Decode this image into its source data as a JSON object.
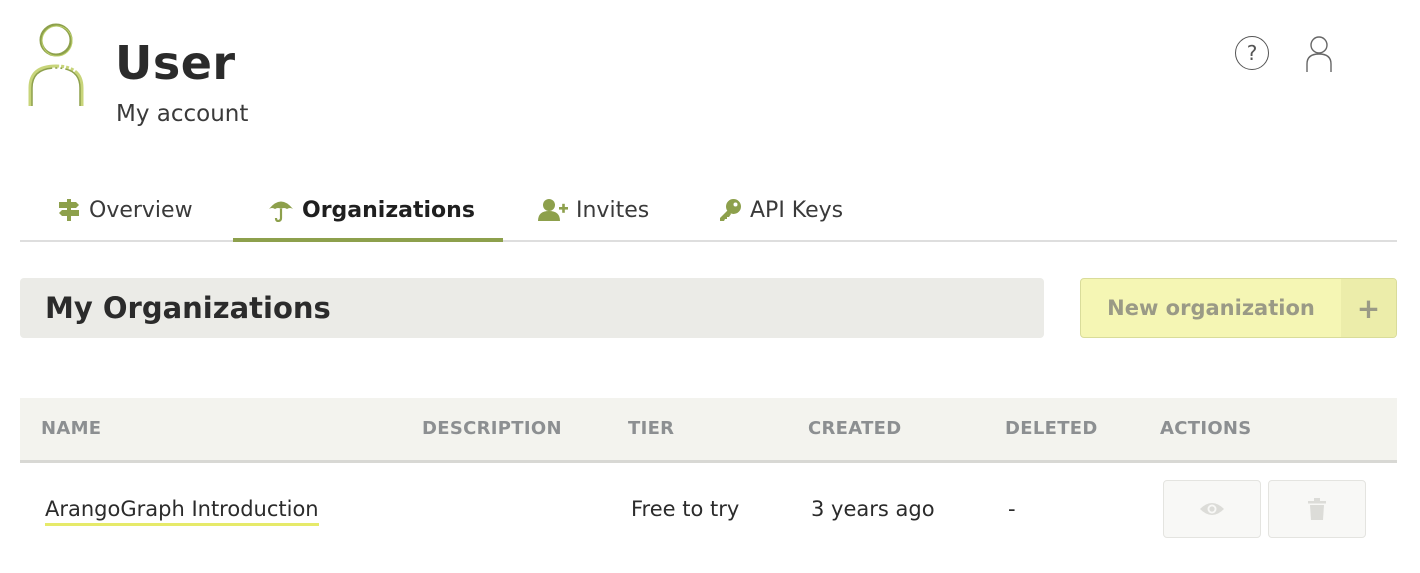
{
  "header": {
    "title": "User",
    "subtitle": "My account",
    "help_icon_glyph": "?"
  },
  "tabs": [
    {
      "label": "Overview",
      "icon": "signpost-icon",
      "active": false
    },
    {
      "label": "Organizations",
      "icon": "umbrella-icon",
      "active": true
    },
    {
      "label": "Invites",
      "icon": "user-plus-icon",
      "active": false
    },
    {
      "label": "API Keys",
      "icon": "key-icon",
      "active": false
    }
  ],
  "section": {
    "title": "My Organizations",
    "new_button_label": "New organization",
    "new_button_plus": "+"
  },
  "table": {
    "columns": [
      "NAME",
      "DESCRIPTION",
      "TIER",
      "CREATED",
      "DELETED",
      "ACTIONS"
    ],
    "rows": [
      {
        "name": "ArangoGraph Introduction",
        "description": "",
        "tier": "Free to try",
        "created": "3 years ago",
        "deleted": "-",
        "actions": [
          "eye-icon",
          "trash-icon"
        ]
      }
    ]
  },
  "colors": {
    "accent": "#8da04c",
    "button_bg": "#f5f6b4",
    "link_underline": "#e6ea6a"
  }
}
